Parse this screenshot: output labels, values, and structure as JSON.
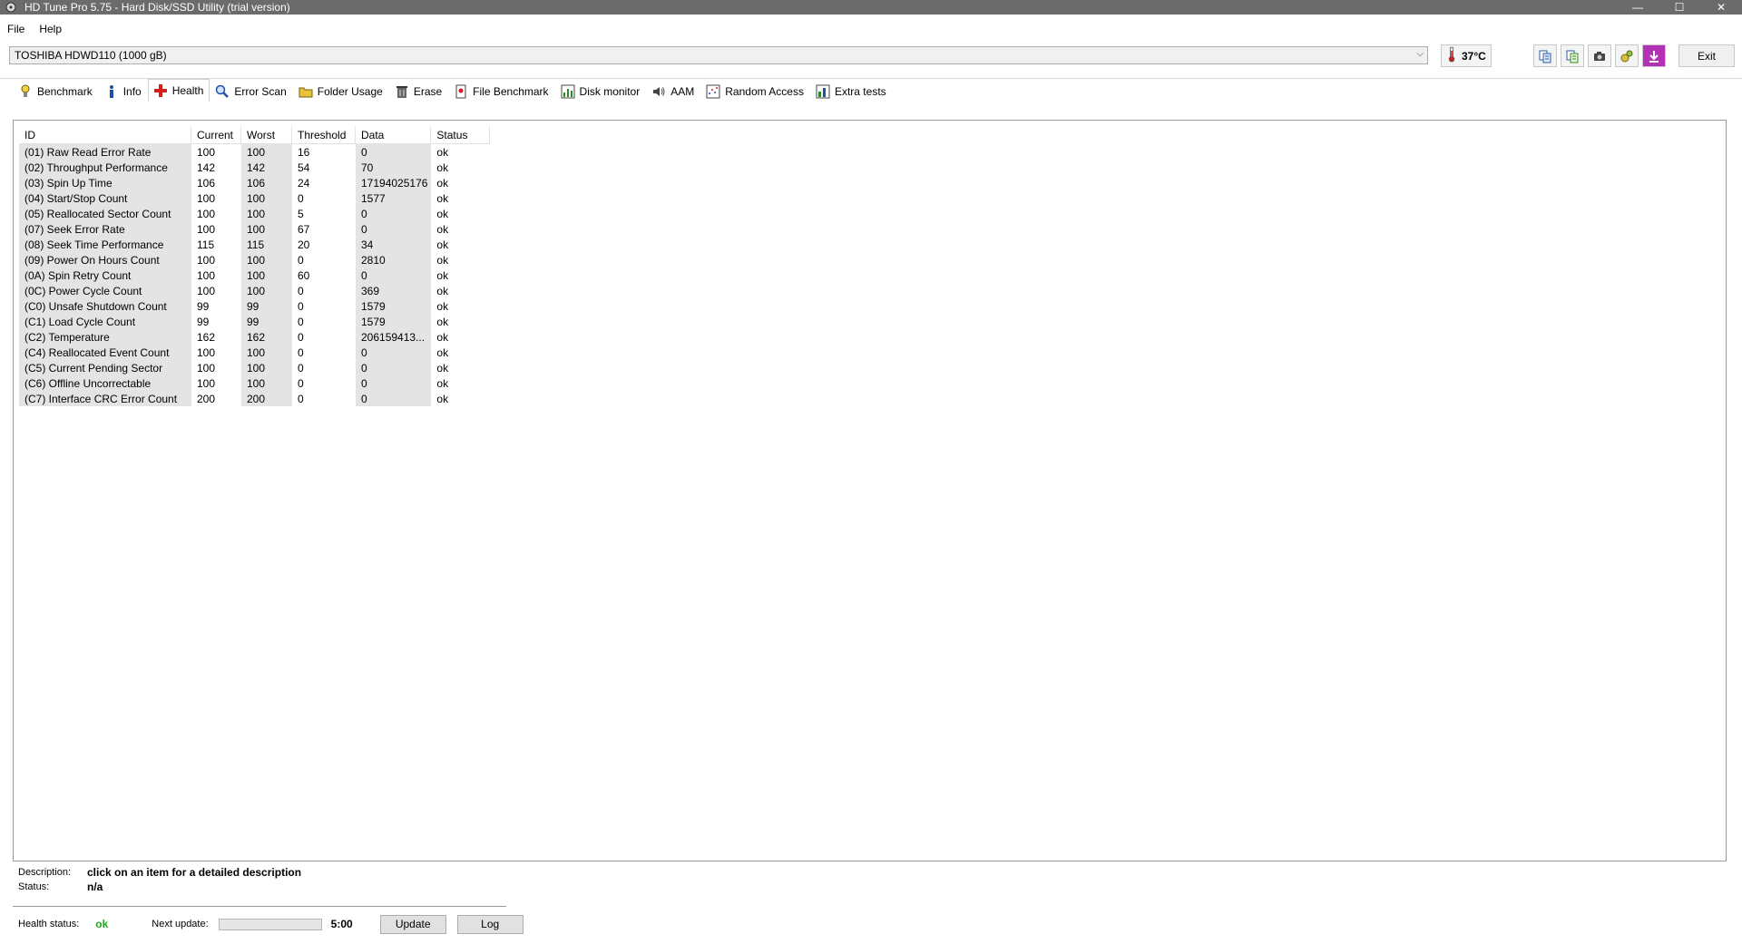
{
  "window": {
    "title": "HD Tune Pro 5.75 - Hard Disk/SSD Utility (trial version)",
    "minimize": "—",
    "maximize": "☐",
    "close": "✕"
  },
  "menu": {
    "file": "File",
    "help": "Help"
  },
  "drive": {
    "selected": "TOSHIBA HDWD110 (1000 gB)"
  },
  "temperature": "37°C",
  "toolbar": {
    "icons": [
      "copy-text-icon",
      "copy-info-icon",
      "camera-icon",
      "options-icon",
      "save-icon"
    ],
    "exit_label": "Exit"
  },
  "tabs": [
    {
      "label": "Benchmark",
      "icon": "benchmark-icon"
    },
    {
      "label": "Info",
      "icon": "info-icon"
    },
    {
      "label": "Health",
      "icon": "health-icon",
      "active": true
    },
    {
      "label": "Error Scan",
      "icon": "error-scan-icon"
    },
    {
      "label": "Folder Usage",
      "icon": "folder-usage-icon"
    },
    {
      "label": "Erase",
      "icon": "erase-icon"
    },
    {
      "label": "File Benchmark",
      "icon": "file-benchmark-icon"
    },
    {
      "label": "Disk monitor",
      "icon": "disk-monitor-icon"
    },
    {
      "label": "AAM",
      "icon": "aam-icon"
    },
    {
      "label": "Random Access",
      "icon": "random-access-icon"
    },
    {
      "label": "Extra tests",
      "icon": "extra-tests-icon"
    }
  ],
  "smart": {
    "columns": [
      "ID",
      "Current",
      "Worst",
      "Threshold",
      "Data",
      "Status"
    ],
    "rows": [
      [
        "(01) Raw Read Error Rate",
        "100",
        "100",
        "16",
        "0",
        "ok"
      ],
      [
        "(02) Throughput Performance",
        "142",
        "142",
        "54",
        "70",
        "ok"
      ],
      [
        "(03) Spin Up Time",
        "106",
        "106",
        "24",
        "17194025176",
        "ok"
      ],
      [
        "(04) Start/Stop Count",
        "100",
        "100",
        "0",
        "1577",
        "ok"
      ],
      [
        "(05) Reallocated Sector Count",
        "100",
        "100",
        "5",
        "0",
        "ok"
      ],
      [
        "(07) Seek Error Rate",
        "100",
        "100",
        "67",
        "0",
        "ok"
      ],
      [
        "(08) Seek Time Performance",
        "115",
        "115",
        "20",
        "34",
        "ok"
      ],
      [
        "(09) Power On Hours Count",
        "100",
        "100",
        "0",
        "2810",
        "ok"
      ],
      [
        "(0A) Spin Retry Count",
        "100",
        "100",
        "60",
        "0",
        "ok"
      ],
      [
        "(0C) Power Cycle Count",
        "100",
        "100",
        "0",
        "369",
        "ok"
      ],
      [
        "(C0) Unsafe Shutdown Count",
        "99",
        "99",
        "0",
        "1579",
        "ok"
      ],
      [
        "(C1) Load Cycle Count",
        "99",
        "99",
        "0",
        "1579",
        "ok"
      ],
      [
        "(C2) Temperature",
        "162",
        "162",
        "0",
        "206159413...",
        "ok"
      ],
      [
        "(C4) Reallocated Event Count",
        "100",
        "100",
        "0",
        "0",
        "ok"
      ],
      [
        "(C5) Current Pending Sector",
        "100",
        "100",
        "0",
        "0",
        "ok"
      ],
      [
        "(C6) Offline Uncorrectable",
        "100",
        "100",
        "0",
        "0",
        "ok"
      ],
      [
        "(C7) Interface CRC Error Count",
        "200",
        "200",
        "0",
        "0",
        "ok"
      ]
    ]
  },
  "bottom": {
    "description_label": "Description:",
    "description_value": "click on an item for a detailed description",
    "status_label": "Status:",
    "status_value": "n/a",
    "health_status_label": "Health status:",
    "health_status_value": "ok",
    "next_update_label": "Next update:",
    "next_update_progress": 0,
    "next_update_time": "5:00",
    "update_label": "Update",
    "log_label": "Log"
  }
}
